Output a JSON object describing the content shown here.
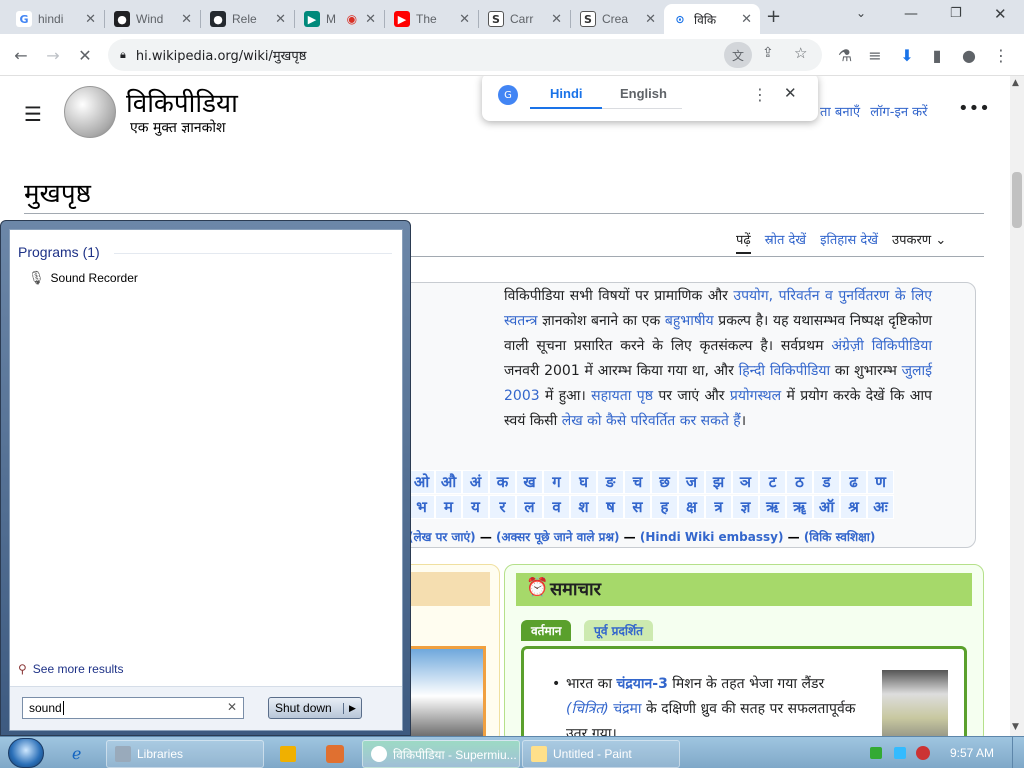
{
  "tabs": [
    {
      "label": "hindi",
      "favicon": "G",
      "color": "#4285f4"
    },
    {
      "label": "Wind",
      "favicon": "●",
      "color": "#202124"
    },
    {
      "label": "Rele",
      "favicon": "●",
      "color": "#24292f"
    },
    {
      "label": "M",
      "favicon": "▶",
      "color": "#00897b"
    },
    {
      "label": "The",
      "favicon": "▶",
      "color": "#ff0000"
    },
    {
      "label": "Carr",
      "favicon": "S",
      "color": "#333333"
    },
    {
      "label": "Crea",
      "favicon": "S",
      "color": "#333333"
    },
    {
      "label": "विकि",
      "favicon": "⊙",
      "color": "#5f6368"
    }
  ],
  "browser": {
    "url": "hi.wikipedia.org/wiki/मुखपृष्ठ",
    "translate_popup": {
      "lang1": "Hindi",
      "lang2": "English"
    }
  },
  "wiki": {
    "logo_title": "विकिपीडिया",
    "logo_tagline": "एक मुक्त ज्ञानकोश",
    "header_links": [
      "ता बनाएँ",
      "लॉग-इन करें"
    ],
    "page_title": "मुखपृष्ठ",
    "tabs": [
      "पढ़ें",
      "स्रोत देखें",
      "इतिहास देखें",
      "उपकरण"
    ],
    "intro": {
      "t1": "विकिपीडिया सभी विषयों पर प्रामाणिक और ",
      "l1": "उपयोग, परिवर्तन व पुनर्वितरण के लिए स्वतन्त्र",
      "t2": " ज्ञानकोश बनाने का एक ",
      "l2": "बहुभाषीय",
      "t3": " प्रकल्प है। यह यथासम्भव निष्पक्ष दृष्टिकोण वाली सूचना प्रसारित करने के लिए कृतसंकल्प है। सर्वप्रथम ",
      "l3": "अंग्रेज़ी विकिपीडिया",
      "t4": " जनवरी 2001 में आरम्भ किया गया था, और ",
      "l4": "हिन्दी विकिपीडिया",
      "t5": " का शुभारम्भ ",
      "l5": "जुलाई 2003",
      "t6": " में हुआ। ",
      "l6": "सहायता पृष्ठ",
      "t7": " पर जाएं और ",
      "l7": "प्रयोगस्थल",
      "t8": " में प्रयोग करके देखें कि आप स्वयं किसी ",
      "l8": "लेख को कैसे परिवर्तित कर सकते हैं",
      "t9": "।"
    },
    "alpha_row1": [
      "ओ",
      "औ",
      "अं",
      "क",
      "ख",
      "ग",
      "घ",
      "ङ",
      "च",
      "छ",
      "ज",
      "झ",
      "ञ",
      "ट",
      "ठ",
      "ड",
      "ढ",
      "ण"
    ],
    "alpha_row2": [
      "भ",
      "म",
      "य",
      "र",
      "ल",
      "व",
      "श",
      "ष",
      "स",
      "ह",
      "क्ष",
      "त्र",
      "ज्ञ",
      "ऋ",
      "ॠ",
      "ऑ",
      "श्र",
      "अः"
    ],
    "links_row": {
      "a": "(लेख पर जाएं)",
      "sep1": " — ",
      "b": "(अक्सर पूछे जाने वाले प्रश्न)",
      "sep2": " — ",
      "c": "(Hindi Wiki embassy)",
      "sep3": " — ",
      "d": "(विकि स्वशिक्षा)"
    },
    "news": {
      "title": "समाचार",
      "tab1": "वर्तमान",
      "tab2": "पूर्व प्रदर्शित",
      "p1": "भारत का ",
      "l1": "चंद्रयान-3",
      "p2": " मिशन के तहत भेजा गया लैंडर ",
      "l2": "(चित्रित)",
      "p3": " ",
      "l3": "चंद्रमा",
      "p4": " के दक्षिणी ध्रुव की सतह पर सफलतापूर्वक उतर गया।"
    }
  },
  "startmenu": {
    "programs_header": "Programs (1)",
    "program": "Sound Recorder",
    "see_more": "See more results",
    "search_value": "sound",
    "shutdown": "Shut down"
  },
  "taskbar": {
    "items": [
      "Libraries",
      "विकिपीडिया - Supermiu...",
      "Untitled - Paint"
    ],
    "time": "9:57 AM"
  }
}
